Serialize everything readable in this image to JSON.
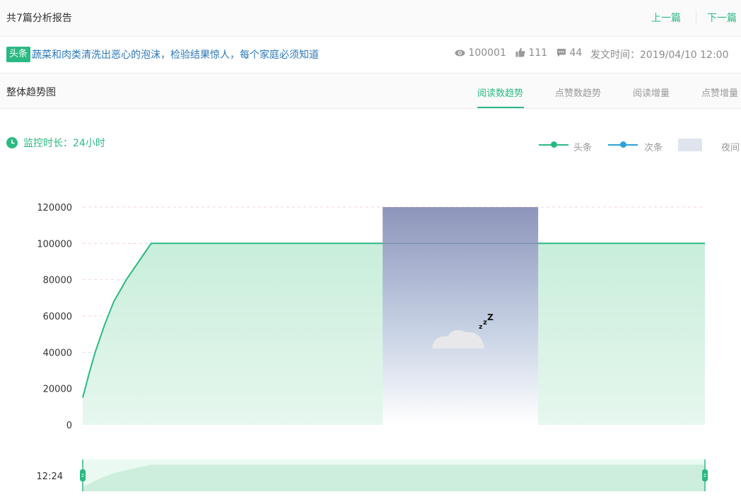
{
  "header": {
    "report_count": "共7篇分析报告",
    "prev_label": "上一篇",
    "next_label": "下一篇"
  },
  "article": {
    "badge": "头条",
    "title": "蔬菜和肉类清洗出恶心的泡沫，检验结果惊人，每个家庭必须知道",
    "views": "100001",
    "likes": "111",
    "comments": "44",
    "publish_time": "发文时间：2019/04/10 12:00"
  },
  "trend": {
    "label": "整体趋势图",
    "tabs": [
      "阅读数趋势",
      "点赞数趋势",
      "阅读增量",
      "点赞增量"
    ],
    "active_tab": 0
  },
  "monitor": {
    "label": "监控时长：24小时"
  },
  "legend": {
    "items": [
      {
        "name": "头条",
        "color": "#2bb983"
      },
      {
        "name": "次条",
        "color": "#2ba3d6"
      }
    ],
    "night_label": "夜间",
    "night_color": "#dfe4ee"
  },
  "chart_data": {
    "type": "area",
    "title": "",
    "xlabel": "",
    "ylabel": "",
    "ylim": [
      0,
      120000
    ],
    "y_ticks": [
      "120000",
      "100000",
      "80000",
      "60000",
      "40000",
      "20000",
      "0"
    ],
    "x_start_label": "12:24",
    "grid": true,
    "legend_placement": "top-right",
    "series": [
      {
        "name": "头条",
        "color": "#2bb983",
        "points": [
          [
            0,
            15000
          ],
          [
            0.01,
            28000
          ],
          [
            0.02,
            40000
          ],
          [
            0.035,
            55000
          ],
          [
            0.05,
            68000
          ],
          [
            0.07,
            80000
          ],
          [
            0.09,
            90000
          ],
          [
            0.11,
            100000
          ],
          [
            1,
            100000
          ]
        ]
      }
    ],
    "night_band": [
      0.482,
      0.732
    ]
  }
}
